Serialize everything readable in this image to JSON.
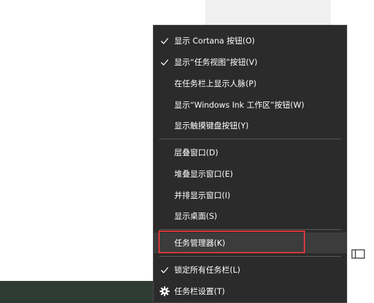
{
  "context_menu": {
    "items": [
      {
        "label": "显示 Cortana 按钮(O)",
        "checked": true
      },
      {
        "label": "显示“任务视图”按钮(V)",
        "checked": true
      },
      {
        "label": "在任务栏上显示人脉(P)",
        "checked": false
      },
      {
        "label": "显示“Windows Ink 工作区”按钮(W)",
        "checked": false
      },
      {
        "label": "显示触摸键盘按钮(Y)",
        "checked": false
      },
      {
        "label": "层叠窗口(D)",
        "checked": false
      },
      {
        "label": "堆叠显示窗口(E)",
        "checked": false
      },
      {
        "label": "并排显示窗口(I)",
        "checked": false
      },
      {
        "label": "显示桌面(S)",
        "checked": false
      },
      {
        "label": "任务管理器(K)",
        "checked": false,
        "highlighted": true
      },
      {
        "label": "锁定所有任务栏(L)",
        "checked": true
      },
      {
        "label": "任务栏设置(T)",
        "checked": false,
        "icon": "gear-icon"
      }
    ]
  },
  "colors": {
    "menu_background": "#2b2b2b",
    "menu_text": "#ffffff",
    "highlight": "#3c3c3c",
    "annotation_box": "#d9383b",
    "taskbar": "#2e3b33"
  },
  "icons": {
    "check": "check-icon",
    "settings": "gear-icon",
    "side": "window-panel-icon"
  }
}
